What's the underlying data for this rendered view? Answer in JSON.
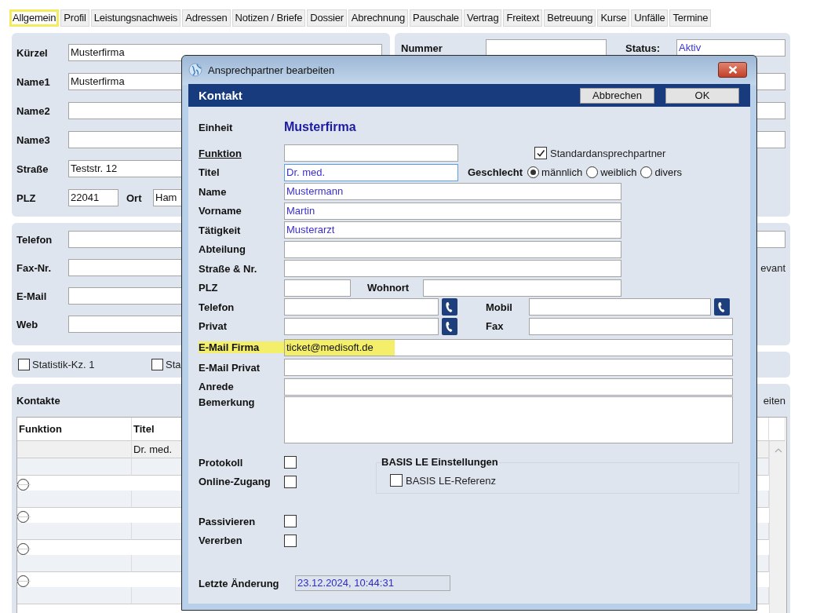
{
  "tabs": [
    {
      "label": "Allgemein",
      "selected": true,
      "highlighted": true
    },
    {
      "label": "Profil",
      "selected": false,
      "highlighted": false
    },
    {
      "label": "Leistungsnachweis",
      "selected": false,
      "highlighted": false
    },
    {
      "label": "Adressen",
      "selected": false,
      "highlighted": false
    },
    {
      "label": "Notizen / Briefe",
      "selected": false,
      "highlighted": false
    },
    {
      "label": "Dossier",
      "selected": false,
      "highlighted": false
    },
    {
      "label": "Abrechnung",
      "selected": false,
      "highlighted": false
    },
    {
      "label": "Pauschale",
      "selected": false,
      "highlighted": false
    },
    {
      "label": "Vertrag",
      "selected": false,
      "highlighted": false
    },
    {
      "label": "Freitext",
      "selected": false,
      "highlighted": false
    },
    {
      "label": "Betreuung",
      "selected": false,
      "highlighted": false
    },
    {
      "label": "Kurse",
      "selected": false,
      "highlighted": false
    },
    {
      "label": "Unfälle",
      "selected": false,
      "highlighted": false
    },
    {
      "label": "Termine",
      "selected": false,
      "highlighted": false
    }
  ],
  "address": {
    "rows": [
      {
        "label": "Kürzel",
        "value": "Musterfirma"
      },
      {
        "label": "Name1",
        "value": "Musterfirma"
      },
      {
        "label": "Name2"
      },
      {
        "label": "Name3"
      },
      {
        "label": "Straße",
        "value": "Teststr. 12"
      }
    ],
    "plz": {
      "label": "PLZ",
      "value": "22041"
    },
    "ort": {
      "label": "Ort",
      "value": "Ham"
    }
  },
  "info": {
    "nummer": {
      "label": "Nummer"
    },
    "status": {
      "label": "Status:",
      "value": "Aktiv"
    }
  },
  "communication": {
    "rows": [
      {
        "label": "Telefon"
      },
      {
        "label": "Fax-Nr."
      },
      {
        "label": "E-Mail"
      },
      {
        "label": "Web"
      }
    ],
    "side_text": "evant"
  },
  "statistics": [
    {
      "label": "Statistik-Kz. 1",
      "checked": false
    },
    {
      "label": "Sta",
      "checked": false
    }
  ],
  "contacts": {
    "title": "Kontakte",
    "side_text": "eiten",
    "columns": [
      "Funktion",
      "Titel"
    ],
    "rows": [
      {
        "titel": "Dr. med."
      }
    ]
  },
  "dialog": {
    "title": "Ansprechpartner bearbeiten",
    "header": {
      "title": "Kontakt",
      "buttons": [
        "Abbrechen",
        "OK"
      ]
    },
    "einheit": {
      "label": "Einheit",
      "value": "Musterfirma"
    },
    "funktion": {
      "label": "Funktion",
      "underlined": true
    },
    "standard": {
      "label": "Standardansprechpartner",
      "checked": true
    },
    "titel": {
      "label": "Titel",
      "value": "Dr. med.",
      "focused": true
    },
    "geschlecht": {
      "label": "Geschlecht",
      "options": [
        {
          "label": "männlich",
          "selected": true
        },
        {
          "label": "weiblich",
          "selected": false
        },
        {
          "label": "divers",
          "selected": false
        }
      ]
    },
    "name": {
      "label": "Name",
      "value": "Mustermann"
    },
    "vorname": {
      "label": "Vorname",
      "value": "Martin"
    },
    "taetigkeit": {
      "label": "Tätigkeit",
      "value": "Musterarzt"
    },
    "abteilung": {
      "label": "Abteilung"
    },
    "strasse": {
      "label": "Straße & Nr."
    },
    "plz": {
      "label": "PLZ"
    },
    "wohnort": {
      "label": "Wohnort"
    },
    "telefon": {
      "label": "Telefon"
    },
    "mobil": {
      "label": "Mobil"
    },
    "privat": {
      "label": "Privat"
    },
    "fax": {
      "label": "Fax"
    },
    "email_firma": {
      "label": "E-Mail Firma",
      "value": "ticket@medisoft.de",
      "highlighted": true
    },
    "email_privat": {
      "label": "E-Mail Privat"
    },
    "anrede": {
      "label": "Anrede"
    },
    "bemerkung": {
      "label": "Bemerkung"
    },
    "protokoll": {
      "label": "Protokoll",
      "checked": false
    },
    "online": {
      "label": "Online-Zugang",
      "checked": false
    },
    "basis": {
      "title": "BASIS LE Einstellungen",
      "option": {
        "label": "BASIS LE-Referenz",
        "checked": false
      }
    },
    "passivieren": {
      "label": "Passivieren",
      "checked": false
    },
    "vererben": {
      "label": "Vererben",
      "checked": false
    },
    "letzte_aenderung": {
      "label": "Letzte Änderung",
      "value": "23.12.2024, 10:44:31"
    }
  }
}
